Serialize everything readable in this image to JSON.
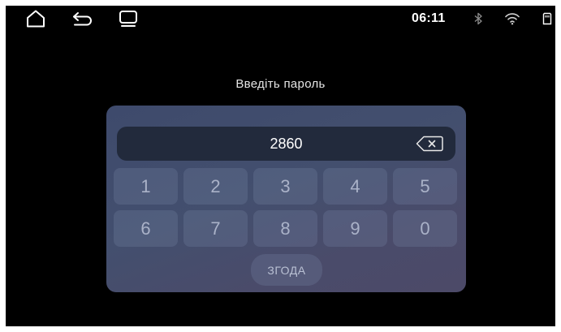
{
  "status_bar": {
    "time": "06:11",
    "icons": [
      "home-icon",
      "back-icon",
      "recent-apps-icon",
      "bluetooth-icon",
      "wifi-icon",
      "sd-card-icon"
    ]
  },
  "dialog": {
    "prompt": "Введіть пароль",
    "password_value": "2860",
    "keys": [
      "1",
      "2",
      "3",
      "4",
      "5",
      "6",
      "7",
      "8",
      "9",
      "0"
    ],
    "confirm_label": "ЗГОДА"
  }
}
